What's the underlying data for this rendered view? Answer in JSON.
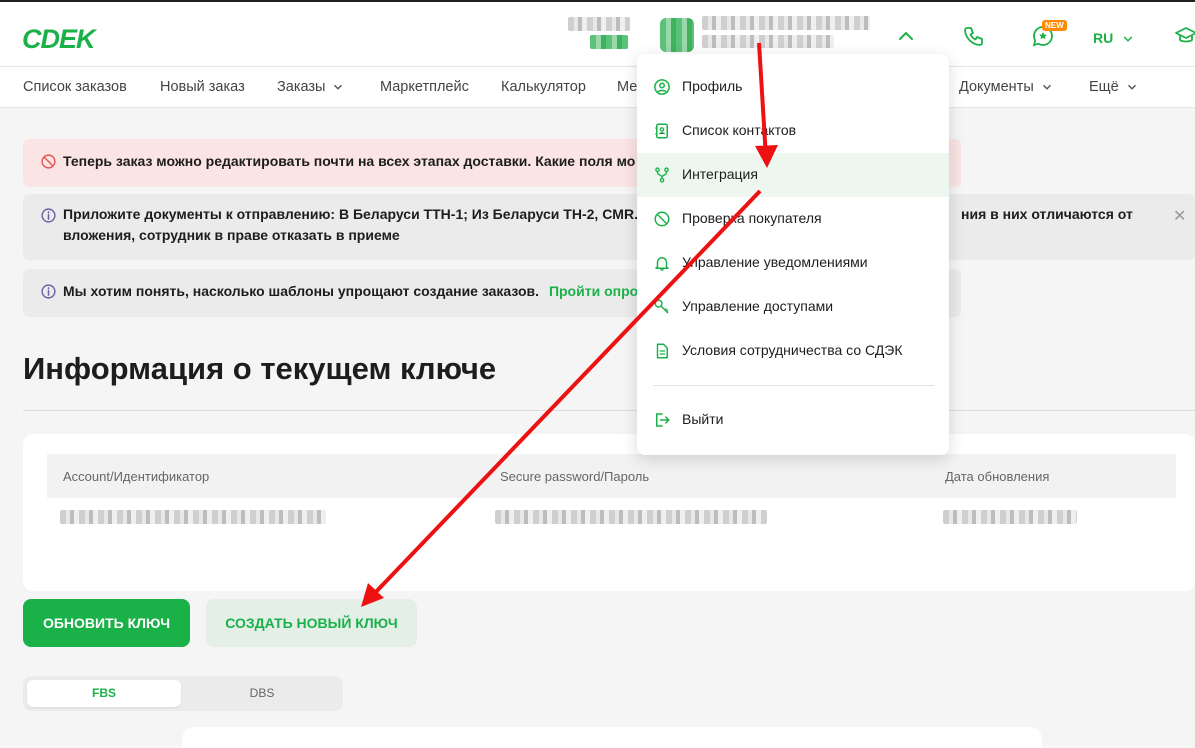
{
  "brand": {
    "logo_text": "CDEK",
    "accent": "#1ab248"
  },
  "header": {
    "language": "RU",
    "new_badge": "NEW"
  },
  "nav": {
    "items": [
      {
        "label": "Список заказов"
      },
      {
        "label": "Новый заказ"
      },
      {
        "label": "Заказы"
      },
      {
        "label": "Маркетплейс"
      },
      {
        "label": "Калькулятор"
      },
      {
        "label": "Ме"
      },
      {
        "label": "Документы"
      },
      {
        "label": "Ещё"
      }
    ]
  },
  "alerts": {
    "red": "Теперь заказ можно редактировать почти на всех этапах доставки. Какие поля мо",
    "docs_line1": "Приложите документы к отправлению: В Беларуси ТТН-1; Из Беларуси ТН-2, CMR.",
    "docs_line1_tail": "ния в них отличаются от",
    "docs_line2": "вложения, сотрудник в праве отказать в приеме",
    "templates_text": "Мы хотим понять, насколько шаблоны упрощают создание заказов.",
    "templates_link": "Пройти опрос"
  },
  "page": {
    "title": "Информация о текущем ключе"
  },
  "key_table": {
    "headers": [
      "Account/Идентификатор",
      "Secure password/Пароль",
      "Дата обновления"
    ]
  },
  "buttons": {
    "refresh": "Обновить ключ",
    "create": "Создать новый ключ"
  },
  "segments": {
    "fbs": "FBS",
    "dbs": "DBS"
  },
  "menu": {
    "items": [
      {
        "label": "Профиль",
        "icon": "user-circle-icon"
      },
      {
        "label": "Список контактов",
        "icon": "contacts-book-icon"
      },
      {
        "label": "Интеграция",
        "icon": "integration-branch-icon"
      },
      {
        "label": "Проверка покупателя",
        "icon": "block-icon"
      },
      {
        "label": "Управление уведомлениями",
        "icon": "bell-icon"
      },
      {
        "label": "Управление доступами",
        "icon": "key-icon"
      },
      {
        "label": "Условия сотрудничества со СДЭК",
        "icon": "document-icon"
      }
    ],
    "logout": {
      "label": "Выйти",
      "icon": "logout-icon"
    }
  }
}
